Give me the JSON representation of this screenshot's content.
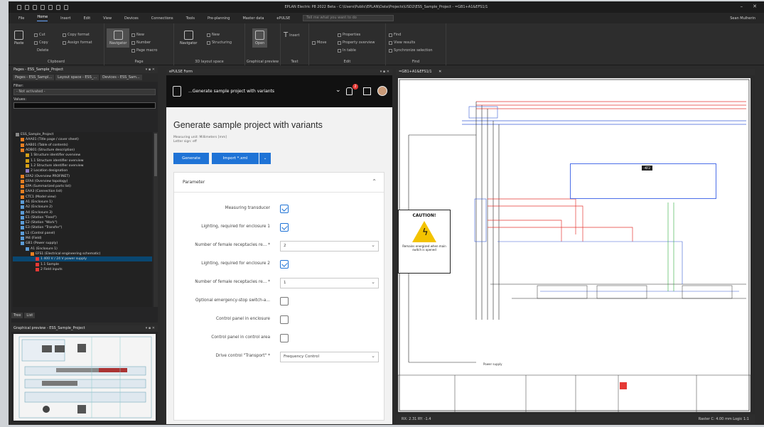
{
  "app": {
    "title": "EPLAN Electric P8 2022 Beta - C:\\Users\\Public\\EPLAN\\Data\\Projects\\USD2\\ESS_Sample_Project - =GB1+A1&EFS1/1",
    "user": "Sean Mulherin"
  },
  "menu": {
    "items": [
      "File",
      "Home",
      "Insert",
      "Edit",
      "View",
      "Devices",
      "Connections",
      "Tools",
      "Pre-planning",
      "Master data",
      "ePULSE"
    ],
    "active": "Home",
    "tell_me": "Tell me what you want to do"
  },
  "ribbon": {
    "clipboard": {
      "label": "Clipboard",
      "paste": "Paste",
      "cut": "Cut",
      "copy": "Copy",
      "delete": "Delete",
      "copy_format": "Copy format",
      "assign_format": "Assign format"
    },
    "page": {
      "label": "Page",
      "navigator": "Navigator",
      "new": "New",
      "number": "Number",
      "page_macro": "Page macro"
    },
    "layout": {
      "label": "3D layout space",
      "navigator": "Navigator",
      "new": "New",
      "structuring": "Structuring"
    },
    "preview": {
      "label": "Graphical preview",
      "open": "Open"
    },
    "text": {
      "label": "Text",
      "insert": "Insert"
    },
    "edit": {
      "label": "Edit",
      "move": "Move",
      "properties": "Properties",
      "property_overview": "Property overview",
      "in_table": "In table"
    },
    "find": {
      "label": "Find",
      "find": "Find",
      "view_results": "View results",
      "sync": "Synchronize selection"
    }
  },
  "pages_panel": {
    "title": "Pages - ESS_Sample_Project",
    "tabs": [
      "Pages - ESS_Sampl...",
      "Layout space - ESS_...",
      "Devices - ESS_Sam..."
    ],
    "filter_label": "Filter:",
    "filter_value": "- Not activated -",
    "values_label": "Values:",
    "tree": [
      {
        "level": 0,
        "text": "ESS_Sample_Project",
        "color": "#888"
      },
      {
        "level": 1,
        "text": "AAA01 (Title page / cover sheet)",
        "color": "#e67e22"
      },
      {
        "level": 1,
        "text": "AAB01 (Table of contents)",
        "color": "#e67e22"
      },
      {
        "level": 1,
        "text": "ADB01 (Structure description)",
        "color": "#e67e22"
      },
      {
        "level": 2,
        "text": "1 Structure identifier overview",
        "color": "#d4a017"
      },
      {
        "level": 2,
        "text": "1.1 Structure identifier overview",
        "color": "#d4a017"
      },
      {
        "level": 2,
        "text": "1.2 Structure identifier overview",
        "color": "#d4a017"
      },
      {
        "level": 2,
        "text": "2 Location designation",
        "color": "#8e7cc3"
      },
      {
        "level": 1,
        "text": "EFA2 (Overview PROFINET)",
        "color": "#e67e22"
      },
      {
        "level": 1,
        "text": "EFA4 (Overview topology)",
        "color": "#e67e22"
      },
      {
        "level": 1,
        "text": "EPA (Summarized parts list)",
        "color": "#e67e22"
      },
      {
        "level": 1,
        "text": "EAA3 (Connection list)",
        "color": "#e67e22"
      },
      {
        "level": 1,
        "text": "CTC1 (Model view)",
        "color": "#e67e22"
      },
      {
        "level": 1,
        "text": "A1 (Enclosure 1)",
        "color": "#5b9bd5"
      },
      {
        "level": 1,
        "text": "A2 (Enclosure 2)",
        "color": "#5b9bd5"
      },
      {
        "level": 1,
        "text": "A4 (Enclosure 3)",
        "color": "#5b9bd5"
      },
      {
        "level": 1,
        "text": "E1 (Station \"Feed\")",
        "color": "#5b9bd5"
      },
      {
        "level": 1,
        "text": "E2 (Station \"Work\")",
        "color": "#5b9bd5"
      },
      {
        "level": 1,
        "text": "E3 (Station \"Transfer\")",
        "color": "#5b9bd5"
      },
      {
        "level": 1,
        "text": "L1 (Control panel)",
        "color": "#5b9bd5"
      },
      {
        "level": 1,
        "text": "M4 (Field)",
        "color": "#5b9bd5"
      },
      {
        "level": 1,
        "text": "GB1 (Power supply)",
        "color": "#5b9bd5"
      },
      {
        "level": 2,
        "text": "A1 (Enclosure 1)",
        "color": "#5b9bd5"
      },
      {
        "level": 3,
        "text": "EFS1 (Electrical engineering schematic)",
        "color": "#e67e22"
      },
      {
        "level": 4,
        "text": "1 400 V / 24 V power supply",
        "color": "#e53935",
        "selected": true
      },
      {
        "level": 4,
        "text": "1.1 Sample",
        "color": "#e53935"
      },
      {
        "level": 4,
        "text": "2 Field inputs",
        "color": "#e53935"
      }
    ],
    "bottom_tabs": [
      "Tree",
      "List"
    ]
  },
  "graphical_preview": {
    "title": "Graphical preview - ESS_Sample_Project"
  },
  "form": {
    "panel_title": "ePULSE Form",
    "header_title": "...Generate sample project with variants",
    "notification_count": "2",
    "title": "Generate sample project with variants",
    "measuring_unit": "Measuring unit: Millimeters [mm]",
    "letter_sign": "Letter sign: eff",
    "generate_label": "Generate",
    "import_label": "Import *.xml",
    "section_title": "Parameter",
    "fields": [
      {
        "label": "Measuring transducer",
        "type": "checkbox",
        "checked": true
      },
      {
        "label": "Lighting, required for enclosure 1",
        "type": "checkbox",
        "checked": true
      },
      {
        "label": "Number of female receptacles re... *",
        "type": "select",
        "value": "2"
      },
      {
        "label": "Lighting, required for enclosure 2",
        "type": "checkbox",
        "checked": true
      },
      {
        "label": "Number of female receptacles re... *",
        "type": "select",
        "value": "1"
      },
      {
        "label": "Optional emergency-stop switch-a...",
        "type": "checkbox",
        "checked": false
      },
      {
        "label": "Control panel in enclosure",
        "type": "checkbox",
        "checked": false
      },
      {
        "label": "Control panel in control area",
        "type": "checkbox",
        "checked": false
      },
      {
        "label": "Drive control \"Transport\" *",
        "type": "select",
        "value": "Frequency Control"
      }
    ]
  },
  "schematic": {
    "tab_title": "=GB1+A1&EFS1/1",
    "caution_title": "CAUTION!",
    "caution_text": "Remains energized when main switch is opened",
    "plc_label": "-KF2",
    "footer_left": "Power supply",
    "status": "RX: 2.31   RY: -1.4",
    "status_right": "Raster C: 4.00 mm   Logic 1:1",
    "colors": {
      "red": "#e53935",
      "blue": "#3c5fd6",
      "green": "#2eaa3a"
    }
  }
}
